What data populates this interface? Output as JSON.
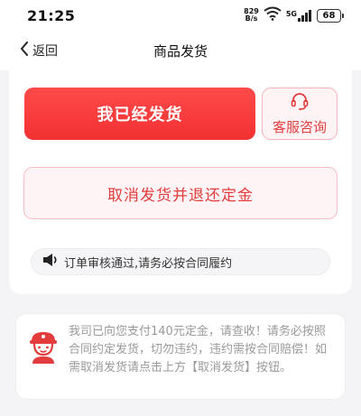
{
  "status_bar": {
    "time": "21:25",
    "net_speed_value": "829",
    "net_speed_unit": "B/s",
    "signal_label": "5G",
    "battery": "68"
  },
  "nav": {
    "back_label": "返回",
    "title": "商品发货"
  },
  "actions": {
    "shipped_label": "我已经发货",
    "service_label": "客服咨询",
    "cancel_label": "取消发货并退还定金"
  },
  "notice": {
    "text": "订单审核通过,请务必按合同履约"
  },
  "tip": {
    "text": "我司已向您支付140元定金，请查收！请务必按照合同约定发货，切勿违约，违约需按合同赔偿！如需取消发货请点击上方【取消发货】按钮。"
  },
  "colors": {
    "primary": "#f23131",
    "accent_text": "#e23c3c",
    "tip_text": "#9a9a9a"
  }
}
